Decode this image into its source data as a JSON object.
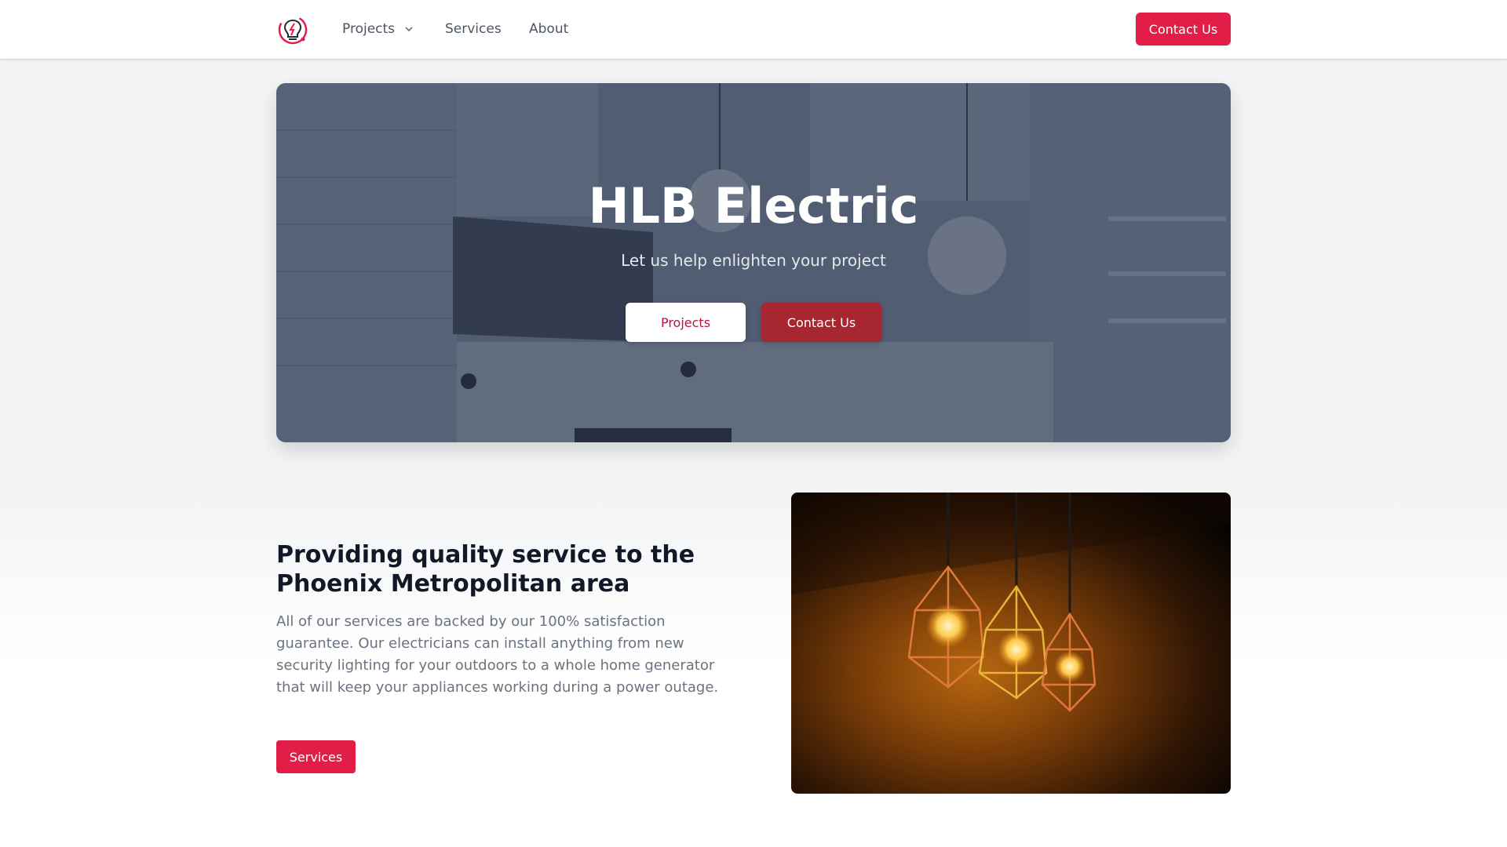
{
  "nav": {
    "logo_alt": "HLB Electric logo",
    "projects_label": "Projects",
    "services_label": "Services",
    "about_label": "About",
    "contact_label": "Contact Us"
  },
  "hero": {
    "title": "HLB Electric",
    "subtitle": "Let us help enlighten your project",
    "projects_button": "Projects",
    "contact_button": "Contact Us"
  },
  "feature": {
    "heading": "Providing quality service to the Phoenix Metropolitan area",
    "body": "All of our services are backed by our 100% satisfaction guarantee. Our electricians can install anything from new security lighting for your outdoors to a whole home generator that will keep your appliances working during a power outage.",
    "button": "Services"
  },
  "colors": {
    "accent": "#e11d48",
    "hero_contact": "#a8262f",
    "heading": "#111827",
    "body_text": "#6b7280"
  },
  "icons": {
    "logo": "lightbulb-logo-icon",
    "projects_dropdown": "chevron-down-icon"
  }
}
